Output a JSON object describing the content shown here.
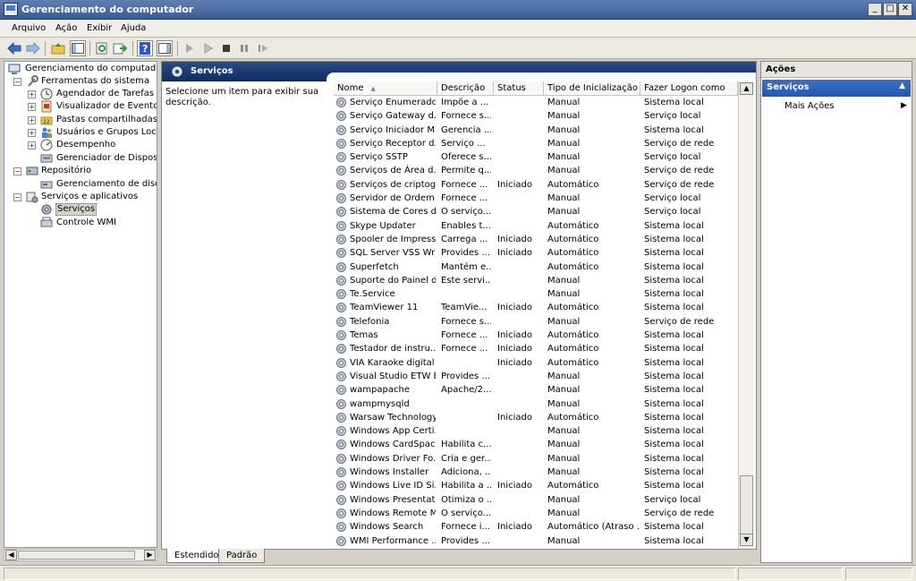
{
  "window": {
    "title": "Gerenciamento do computador"
  },
  "menu": [
    "Arquivo",
    "Ação",
    "Exibir",
    "Ajuda"
  ],
  "tree": {
    "root": "Gerenciamento do computador (lo",
    "nodes": [
      "Ferramentas do sistema",
      "Agendador de Tarefas",
      "Visualizador de Eventos",
      "Pastas compartilhadas",
      "Usuários e Grupos Locais",
      "Desempenho",
      "Gerenciador de Dispositiv",
      "Repositório",
      "Gerenciamento de disco",
      "Serviços e aplicativos",
      "Serviços",
      "Controle WMI"
    ]
  },
  "center": {
    "header": "Serviços",
    "description": "Selecione um item para exibir sua descrição.",
    "columns": [
      "Nome",
      "Descrição",
      "Status",
      "Tipo de Inicialização",
      "Fazer Logon como"
    ],
    "rows": [
      [
        "Serviço Enumerado...",
        "Impõe a ...",
        "",
        "Manual",
        "Sistema local"
      ],
      [
        "Serviço Gateway d...",
        "Fornece s...",
        "",
        "Manual",
        "Serviço local"
      ],
      [
        "Serviço Iniciador Mi...",
        "Gerencia ...",
        "",
        "Manual",
        "Sistema local"
      ],
      [
        "Serviço Receptor d...",
        "Serviço ...",
        "",
        "Manual",
        "Serviço de rede"
      ],
      [
        "Serviço SSTP",
        "Oferece s...",
        "",
        "Manual",
        "Serviço local"
      ],
      [
        "Serviços de Área d...",
        "Permite q...",
        "",
        "Manual",
        "Serviço de rede"
      ],
      [
        "Serviços de criptog...",
        "Fornece ...",
        "Iniciado",
        "Automático",
        "Serviço de rede"
      ],
      [
        "Servidor de Ordem ...",
        "Fornece ...",
        "",
        "Manual",
        "Serviço local"
      ],
      [
        "Sistema de Cores d...",
        "O serviço...",
        "",
        "Manual",
        "Serviço local"
      ],
      [
        "Skype Updater",
        "Enables t...",
        "",
        "Automático",
        "Sistema local"
      ],
      [
        "Spooler de Impressão",
        "Carrega ...",
        "Iniciado",
        "Automático",
        "Sistema local"
      ],
      [
        "SQL Server VSS Wri...",
        "Provides ...",
        "Iniciado",
        "Automático",
        "Sistema local"
      ],
      [
        "Superfetch",
        "Mantém e...",
        "",
        "Automático",
        "Sistema local"
      ],
      [
        "Suporte do Painel d...",
        "Este servi...",
        "",
        "Manual",
        "Sistema local"
      ],
      [
        "Te.Service",
        "",
        "",
        "Manual",
        "Sistema local"
      ],
      [
        "TeamViewer 11",
        "TeamVie...",
        "Iniciado",
        "Automático",
        "Sistema local"
      ],
      [
        "Telefonia",
        "Fornece s...",
        "",
        "Manual",
        "Serviço de rede"
      ],
      [
        "Temas",
        "Fornece ...",
        "Iniciado",
        "Automático",
        "Sistema local"
      ],
      [
        "Testador de instru...",
        "Fornece ...",
        "Iniciado",
        "Automático",
        "Sistema local"
      ],
      [
        "VIA Karaoke digital ...",
        "",
        "Iniciado",
        "Automático",
        "Sistema local"
      ],
      [
        "Visual Studio ETW E...",
        "Provides ...",
        "",
        "Manual",
        "Sistema local"
      ],
      [
        "wampapache",
        "Apache/2...",
        "",
        "Manual",
        "Sistema local"
      ],
      [
        "wampmysqld",
        "",
        "",
        "Manual",
        "Sistema local"
      ],
      [
        "Warsaw Technology",
        "",
        "Iniciado",
        "Automático",
        "Sistema local"
      ],
      [
        "Windows App Certi...",
        "",
        "",
        "Manual",
        "Sistema local"
      ],
      [
        "Windows CardSpace",
        "Habilita c...",
        "",
        "Manual",
        "Sistema local"
      ],
      [
        "Windows Driver Fo...",
        "Cria e ger...",
        "",
        "Manual",
        "Sistema local"
      ],
      [
        "Windows Installer",
        "Adiciona, ...",
        "",
        "Manual",
        "Sistema local"
      ],
      [
        "Windows Live ID Si...",
        "Habilita a ...",
        "Iniciado",
        "Automático",
        "Sistema local"
      ],
      [
        "Windows Presentat...",
        "Otimiza o ...",
        "",
        "Manual",
        "Serviço local"
      ],
      [
        "Windows Remote M...",
        "O serviço...",
        "",
        "Manual",
        "Serviço de rede"
      ],
      [
        "Windows Search",
        "Fornece i...",
        "Iniciado",
        "Automático (Atraso ...",
        "Sistema local"
      ],
      [
        "WMI Performance ...",
        "Provides ...",
        "",
        "Manual",
        "Sistema local"
      ]
    ]
  },
  "tabs": [
    "Estendido",
    "Padrão"
  ],
  "actions": {
    "title": "Ações",
    "group": "Serviços",
    "items": [
      "Mais Ações"
    ]
  }
}
